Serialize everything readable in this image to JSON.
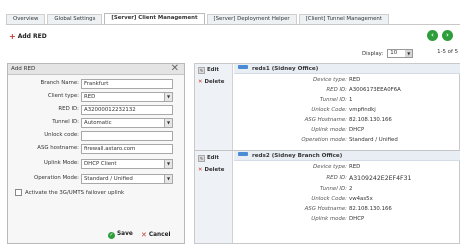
{
  "tabs": [
    "Overview",
    "Global Settings",
    "[Server] Client Management",
    "[Server] Deployment Helper",
    "[Client] Tunnel Management"
  ],
  "toolbar": {
    "add_label": "Add RED",
    "display_label": "Display:",
    "display_value": "10",
    "range": "1-5 of 5"
  },
  "form": {
    "title": "Add RED",
    "branch_name_label": "Branch Name:",
    "branch_name_value": "Frankfurt",
    "client_type_label": "Client type:",
    "client_type_value": "RED",
    "red_id_label": "RED ID:",
    "red_id_value": "A32000012232132",
    "tunnel_id_label": "Tunnel ID:",
    "tunnel_id_value": "Automatic",
    "unlock_label": "Unlock code:",
    "unlock_value": "",
    "asg_label": "ASG hostname:",
    "asg_value": "firewall.astaro.com",
    "uplink_label": "Uplink Mode:",
    "uplink_value": "DHCP Client",
    "opmode_label": "Operation Mode:",
    "opmode_value": "Standard / Unified",
    "failover_label": "Activate the 3G/UMTS failover uplink",
    "save_label": "Save",
    "cancel_label": "Cancel"
  },
  "list": {
    "edit_label": "Edit",
    "delete_label": "Delete",
    "items": [
      {
        "title": "reds1 (Sidney Office)",
        "details": [
          {
            "k": "Device type:",
            "v": "RED"
          },
          {
            "k": "RED ID:",
            "v": "A3006173EEA0F6A"
          },
          {
            "k": "Tunnel ID:",
            "v": "1"
          },
          {
            "k": "Unlock Code:",
            "v": "vmpfindkj"
          },
          {
            "k": "ASG Hostname:",
            "v": "82.108.130.166"
          },
          {
            "k": "Uplink mode:",
            "v": "DHCP"
          },
          {
            "k": "Operation mode:",
            "v": "Standard / Unified"
          }
        ]
      },
      {
        "title": "reds2 (Sidney Branch Office)",
        "details": [
          {
            "k": "Device type:",
            "v": "RED"
          },
          {
            "k": "RED ID:",
            "v": "A3109242E2EF4F31"
          },
          {
            "k": "Tunnel ID:",
            "v": "2"
          },
          {
            "k": "Unlock Code:",
            "v": "vw4as5x"
          },
          {
            "k": "ASG Hostname:",
            "v": "82.108.130.166"
          },
          {
            "k": "Uplink mode:",
            "v": "DHCP"
          }
        ]
      }
    ]
  }
}
